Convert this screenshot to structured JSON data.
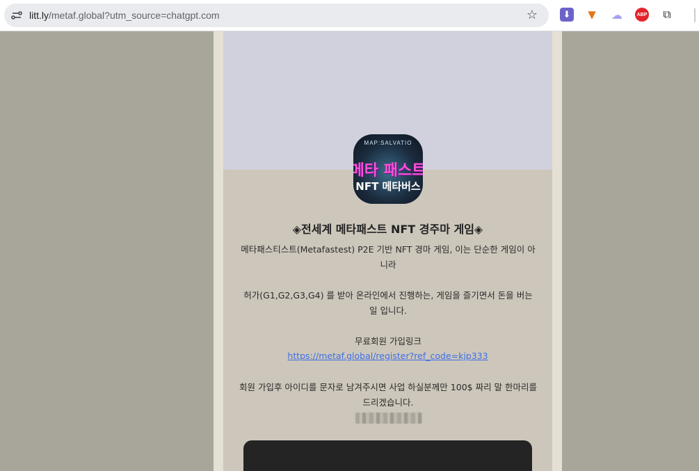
{
  "browser": {
    "url_host": "litt.ly",
    "url_rest": "/metaf.global?utm_source=chatgpt.com",
    "star_icon": "☆",
    "extensions": [
      "download-icon",
      "metamask-fox-icon",
      "purple-extension-icon",
      "adblock-plus-icon",
      "puzzle-icon"
    ],
    "abp_label": "ABP"
  },
  "profile": {
    "top_text": "MAP:SALVATIO",
    "mid_text": "메타 패스트",
    "bottom_text": "NFT 메타버스"
  },
  "content": {
    "title": "◈전세계 메타패스트 NFT 경주마 게임◈",
    "paragraph1": "메타패스티스트(Metafastest) P2E 기반 NFT 경마 게임, 이는 단순한 게임이 아니라",
    "paragraph2": "허가(G1,G2,G3,G4) 를 받아  온라인에서 진행하는, 게임을 즐기면서 돈을 버는 일 입니다.",
    "signup_label": "무료회원 가입링크",
    "signup_link": "https://metaf.global/register?ref_code=kjp333",
    "paragraph3": "회원 가입후 아이디를 문자로 남겨주시면  사업 하실분께만 100$ 짜리 말 한마리를 드리겠습니다."
  },
  "colors": {
    "page_bg": "#a8a59a",
    "card_bg": "#cdc7bb",
    "banner_bg": "#d0d1dc",
    "link": "#3d6ee8"
  }
}
